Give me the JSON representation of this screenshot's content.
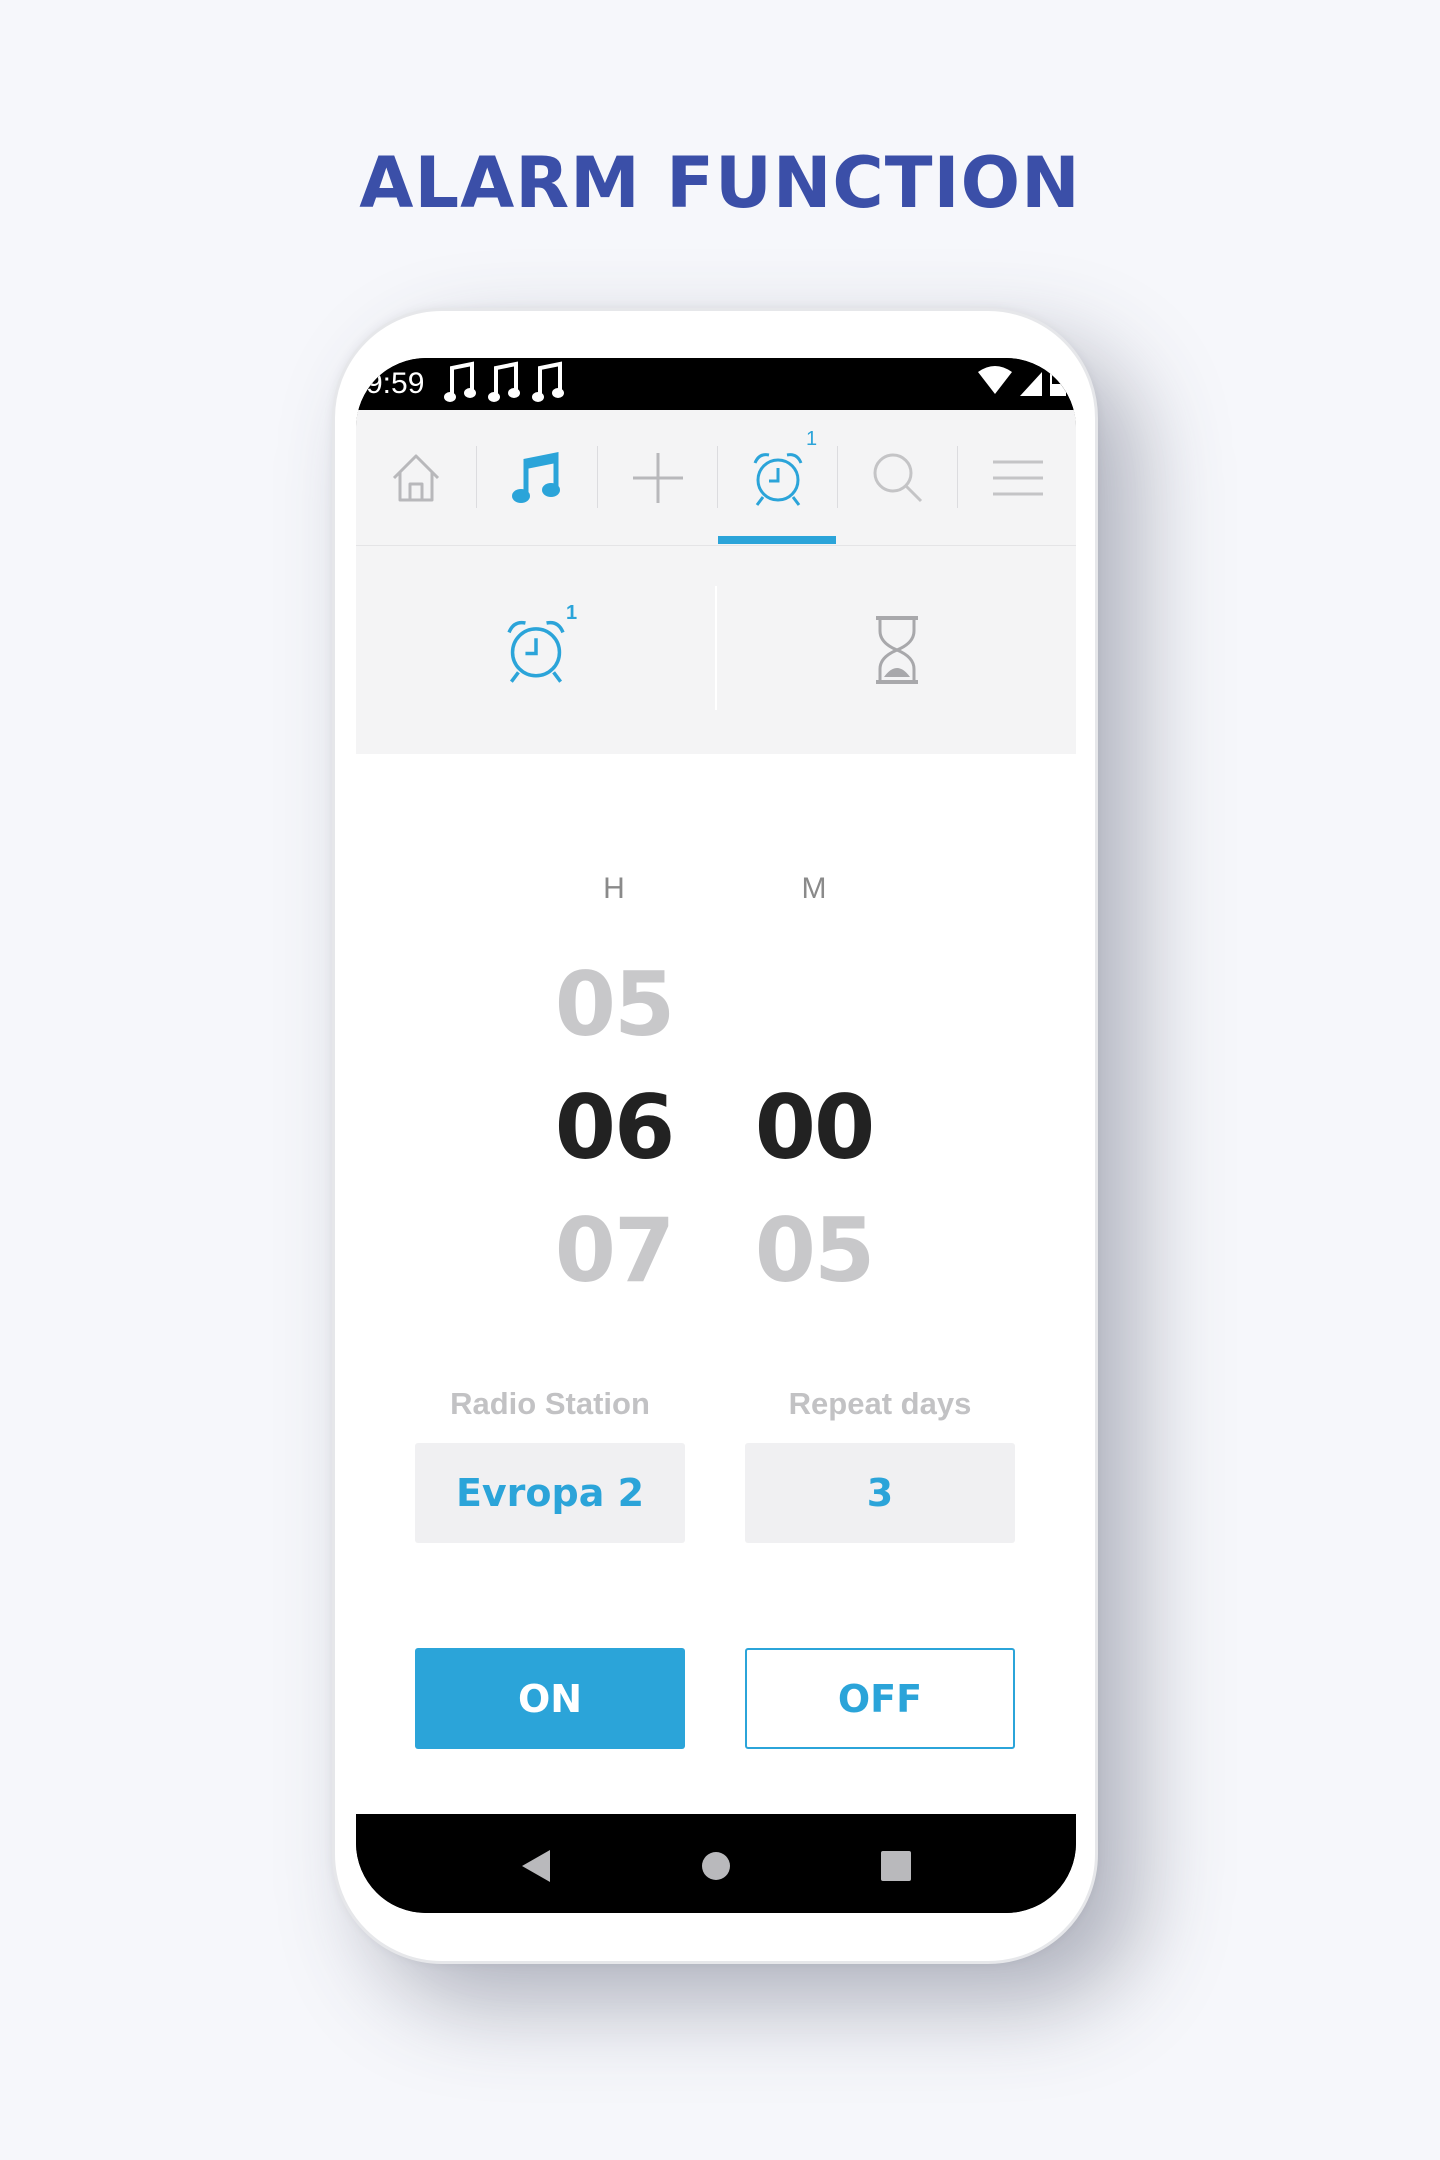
{
  "headline": "ALARM FUNCTION",
  "status_bar": {
    "time": "9:59",
    "left_icons": [
      "music-note-icon",
      "music-note-icon",
      "music-note-icon"
    ],
    "right_icons": [
      "wifi-icon",
      "signal-icon",
      "battery-icon"
    ]
  },
  "top_nav": {
    "tabs": [
      {
        "icon": "home-icon",
        "active": false
      },
      {
        "icon": "music-note-icon",
        "active": false
      },
      {
        "icon": "plus-icon",
        "active": false
      },
      {
        "icon": "alarm-clock-icon",
        "active": true,
        "badge": "1"
      },
      {
        "icon": "search-icon",
        "active": false
      },
      {
        "icon": "menu-icon",
        "active": false
      }
    ]
  },
  "sub_nav": {
    "alarm_badge": "1",
    "tabs": [
      "alarm-clock-icon",
      "hourglass-icon"
    ]
  },
  "picker": {
    "hours_label": "H",
    "minutes_label": "M",
    "hour_prev": "05",
    "hour_current": "06",
    "hour_next": "07",
    "minute_current": "00",
    "minute_next": "05"
  },
  "fields": {
    "radio_label": "Radio Station",
    "radio_value": "Evropa 2",
    "repeat_label": "Repeat days",
    "repeat_value": "3"
  },
  "buttons": {
    "on": "ON",
    "off": "OFF"
  },
  "system_nav": [
    "back-icon",
    "home-circle-icon",
    "recents-icon"
  ],
  "colors": {
    "accent": "#2ba4d9",
    "headline": "#3b4fa8",
    "background": "#f6f7fb"
  }
}
